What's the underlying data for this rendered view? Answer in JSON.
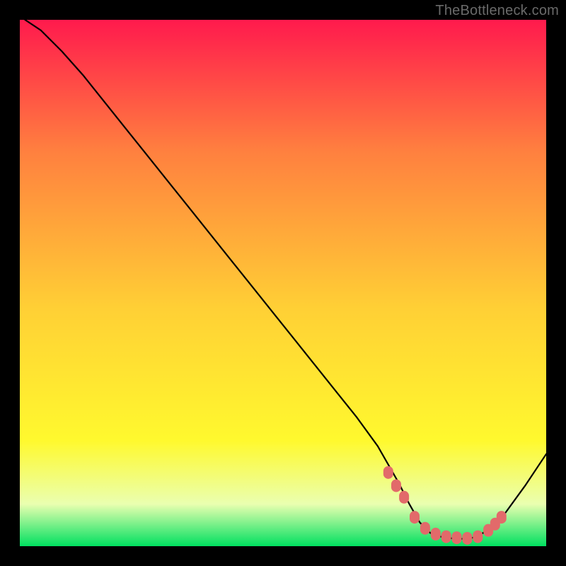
{
  "watermark": {
    "text": "TheBottleneck.com"
  },
  "chart_data": {
    "type": "line",
    "title": "",
    "xlabel": "",
    "ylabel": "",
    "xlim": [
      0,
      100
    ],
    "ylim": [
      0,
      100
    ],
    "grid": false,
    "legend": false,
    "gradient_bg": {
      "top_color": "#ff1a4d",
      "mid1_color": "#ff803f",
      "mid2_color": "#ffd035",
      "mid3_color": "#fff92e",
      "bottom_color": "#00e060"
    },
    "line_color": "#000000",
    "marker_color": "#e26a6a",
    "series": [
      {
        "name": "bottleneck-curve",
        "x": [
          1,
          4,
          8,
          12,
          16,
          20,
          24,
          28,
          32,
          36,
          40,
          44,
          48,
          52,
          56,
          60,
          64,
          68,
          72,
          74,
          76,
          78,
          80,
          82,
          84,
          86,
          88,
          92,
          96,
          100
        ],
        "y": [
          100,
          98,
          94,
          89.5,
          84.5,
          79.5,
          74.5,
          69.5,
          64.5,
          59.5,
          54.5,
          49.5,
          44.5,
          39.5,
          34.5,
          29.5,
          24.5,
          19,
          12,
          8,
          4.5,
          2.5,
          1.8,
          1.5,
          1.4,
          1.6,
          2.5,
          6,
          11.5,
          17.5
        ]
      }
    ],
    "markers": {
      "name": "highlight-dots",
      "x": [
        70,
        71.5,
        73,
        75,
        77,
        79,
        81,
        83,
        85,
        87,
        89,
        90.3,
        91.5
      ],
      "y": [
        14,
        11.5,
        9.3,
        5.5,
        3.4,
        2.3,
        1.8,
        1.6,
        1.5,
        1.8,
        3,
        4.2,
        5.5
      ]
    }
  }
}
